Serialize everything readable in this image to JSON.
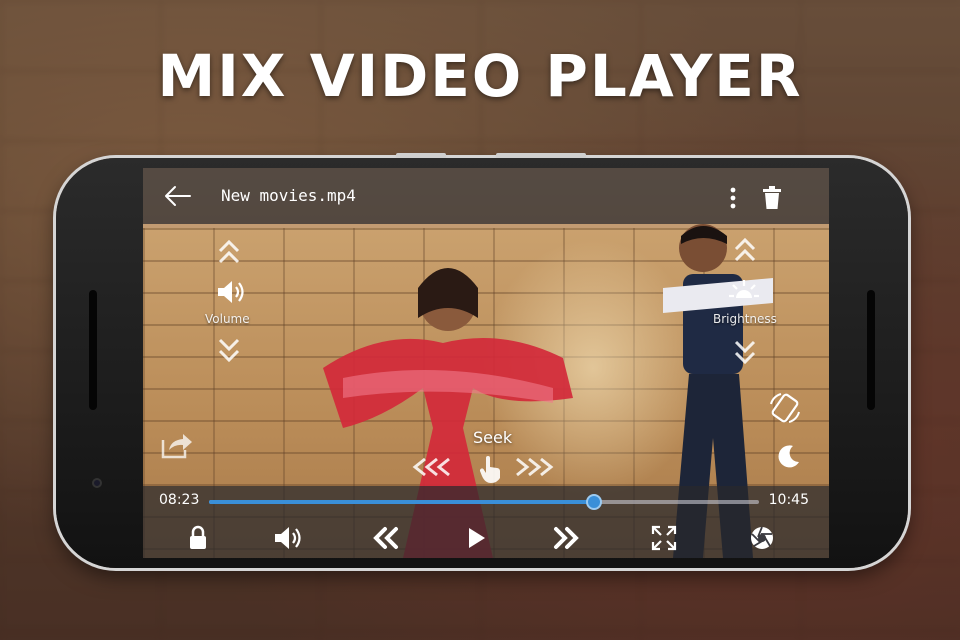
{
  "promo": {
    "headline": "MIX VIDEO PLAYER"
  },
  "player": {
    "file_name": "New movies.mp4",
    "gestures": {
      "volume_label": "Volume",
      "brightness_label": "Brightness",
      "seek_label": "Seek"
    },
    "playback": {
      "current_time": "08:23",
      "duration": "10:45",
      "progress": 0.7,
      "state": "paused"
    },
    "icons": {
      "back": "arrow-left-icon",
      "more": "more-vertical-icon",
      "delete": "trash-icon",
      "volume": "speaker-icon",
      "brightness": "sun-icon",
      "rotate": "screen-rotation-icon",
      "night": "moon-icon",
      "share": "share-icon",
      "lock": "lock-icon",
      "rewind": "rewind-icon",
      "play": "play-icon",
      "forward": "fast-forward-icon",
      "fullscreen": "fullscreen-icon",
      "screenshot": "camera-shutter-icon"
    },
    "colors": {
      "accent": "#3a8fd8",
      "overlay": "#28282d"
    }
  }
}
